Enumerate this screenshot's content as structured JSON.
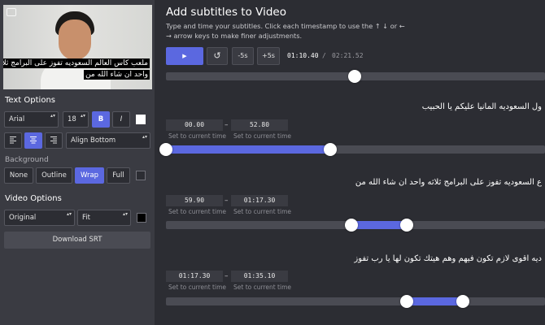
{
  "video": {
    "caption_line1": "ملعب كاس العالم السعوديه تفوز على البرامج ثلاثه",
    "caption_line2": "واحد ان شاء الله من"
  },
  "text_options": {
    "title": "Text Options",
    "font": "Arial",
    "size": "18",
    "bold_label": "B",
    "italic_label": "I",
    "color": "#ffffff",
    "position": "Align Bottom"
  },
  "background": {
    "title": "Background",
    "options": [
      "None",
      "Outline",
      "Wrap",
      "Full"
    ],
    "selected": "Wrap",
    "color": "#2c2d33"
  },
  "video_options": {
    "title": "Video Options",
    "size": "Original",
    "fit": "Fit",
    "color": "#000000"
  },
  "download_label": "Download SRT",
  "main": {
    "title": "Add subtitles to Video",
    "description": "Type and time your subtitles. Click each timestamp to use the ↑ ↓ or ← → arrow keys to make finer adjustments.",
    "toolbar": {
      "play": "▶",
      "reset": "↺",
      "minus": "-5s",
      "plus": "+5s"
    },
    "time_current": "01:10.40",
    "time_sep": "/",
    "time_total": "02:21.52",
    "seek_fraction": 0.498
  },
  "set_label": "Set to current time",
  "subtitles": [
    {
      "text": "ول السعوديه المانيا عليكم يا الحبيب",
      "start": "00.00",
      "end": "52.80",
      "start_frac": 0.0,
      "end_frac": 0.434
    },
    {
      "text": "ع السعوديه تفوز على البرامج ثلاثه واحد ان شاء الله من",
      "start": "59.90",
      "end": "01:17.30",
      "start_frac": 0.49,
      "end_frac": 0.636
    },
    {
      "text": "ديه اقوى لازم تكون فيهم وهم هيتك تكون لها يا رب تفوز",
      "start": "01:17.30",
      "end": "01:35.10",
      "start_frac": 0.636,
      "end_frac": 0.783
    }
  ],
  "colors": {
    "accent": "#5b68e0",
    "panel": "#3a3b42",
    "bg": "#2c2d33"
  }
}
